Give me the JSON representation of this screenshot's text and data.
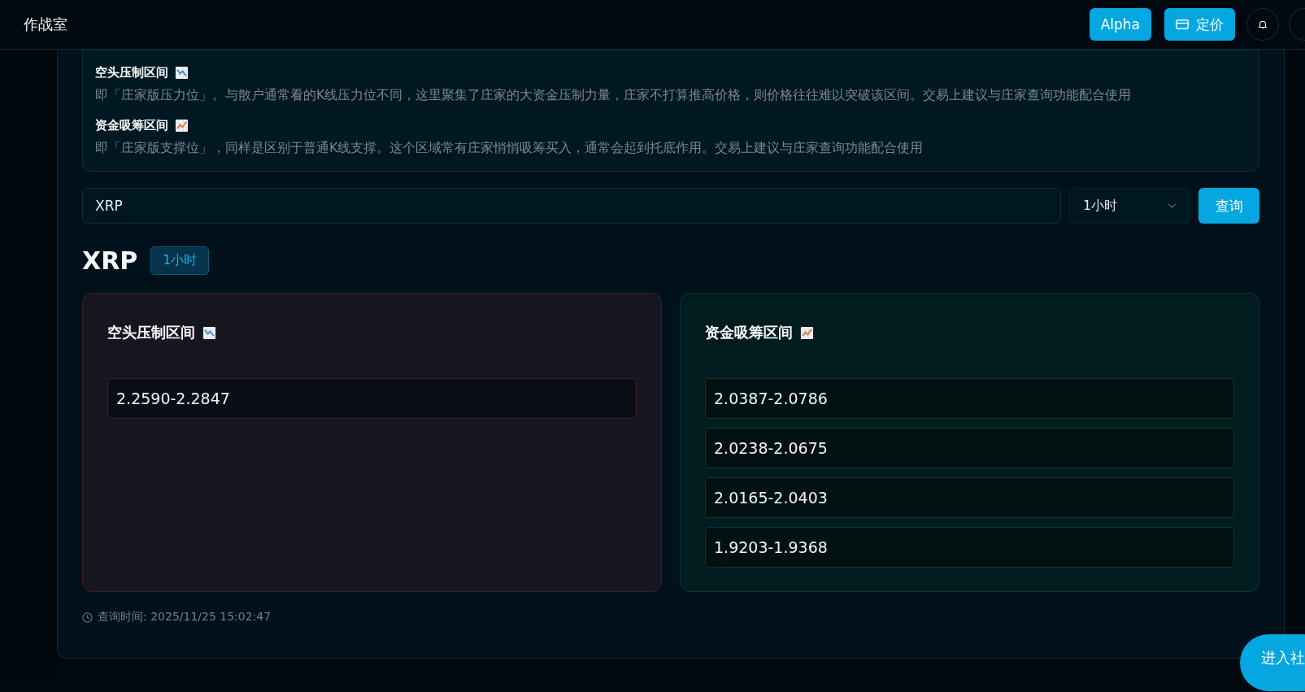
{
  "header": {
    "title": "作战室",
    "buttons": [
      {
        "label": "Alpha",
        "kind": "text"
      },
      {
        "label": "定价",
        "kind": "icon"
      }
    ]
  },
  "info": [
    {
      "title": "空头压制区间",
      "kind": "resistance",
      "text": "即「庄家版压力位」。与散户通常看的K线压力位不同，这里聚集了庄家的大资金压制力量，庄家不打算推高价格，则价格往往难以突破该区间。交易上建议与庄家查询功能配合使用"
    },
    {
      "title": "资金吸筹区间",
      "kind": "support",
      "text": "即「庄家版支撑位」，同样是区别于普通K线支撑。这个区域常有庄家悄悄吸筹买入，通常会起到托底作用。交易上建议与庄家查询功能配合使用"
    }
  ],
  "query": {
    "symbol": "XRP",
    "interval": "1小时",
    "button": "查询"
  },
  "result": {
    "symbol": "XRP",
    "interval": "1小时",
    "panels": [
      {
        "title": "空头压制区间",
        "kind": "resistance",
        "ranges": [
          "2.2590-2.2847"
        ]
      },
      {
        "title": "资金吸筹区间",
        "kind": "support",
        "ranges": [
          "2.0387-2.0786",
          "2.0238-2.0675",
          "2.0165-2.0403",
          "1.9203-1.9368"
        ]
      }
    ],
    "query_time": "查询时间: 2025/11/25 15:02:47"
  },
  "fab": {
    "label": "进入社"
  }
}
